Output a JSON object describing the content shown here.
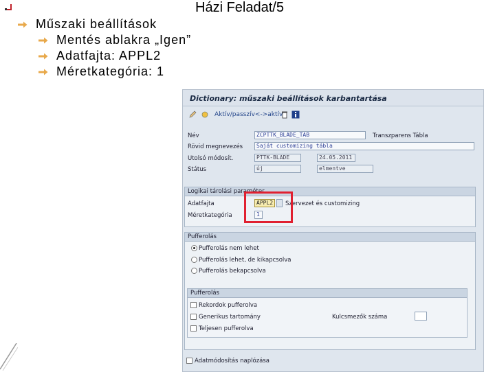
{
  "slide": {
    "title": "Házi Feladat/5",
    "bullets": [
      {
        "text": "Műszaki beállítások"
      },
      {
        "text": "Mentés ablakra „Igen”"
      },
      {
        "text": "Adatfajta: APPL2"
      },
      {
        "text": "Méretkategória: 1"
      }
    ]
  },
  "sap": {
    "window_title": "Dictionary: műszaki beállítások karbantartása",
    "toolbar": {
      "link": "Aktív/passzív<->aktív"
    },
    "header": {
      "name_label": "Név",
      "name_value": "ZCPTTK_BLADE_TAB",
      "name_type": "Transzparens Tábla",
      "short_desc_label": "Rövid megnevezés",
      "short_desc_value": "Saját customizing tábla",
      "last_changed_label": "Utolsó módosít.",
      "last_changed_user": "PTTK-BLADE",
      "last_changed_date": "24.05.2011",
      "status_label": "Státus",
      "status_value": "új",
      "status_text": "elmentve"
    },
    "logical": {
      "title": "Logikai tárolási paraméter",
      "data_class_label": "Adatfajta",
      "data_class_value": "APPL2",
      "data_class_desc": "Szervezet és customizing",
      "size_label": "Méretkategória",
      "size_value": "1"
    },
    "buffering": {
      "title": "Pufferolás",
      "options": [
        "Pufferolás nem lehet",
        "Pufferolás lehet, de kikapcsolva",
        "Pufferolás bekapcsolva"
      ]
    },
    "buffer_type": {
      "title": "Pufferolás",
      "options": [
        "Rekordok pufferolva",
        "Generikus tartomány",
        "Teljesen pufferolva"
      ],
      "key_count_label": "Kulcsmezők száma",
      "key_count_value": ""
    },
    "log_label": "Adatmódosítás naplózása"
  }
}
